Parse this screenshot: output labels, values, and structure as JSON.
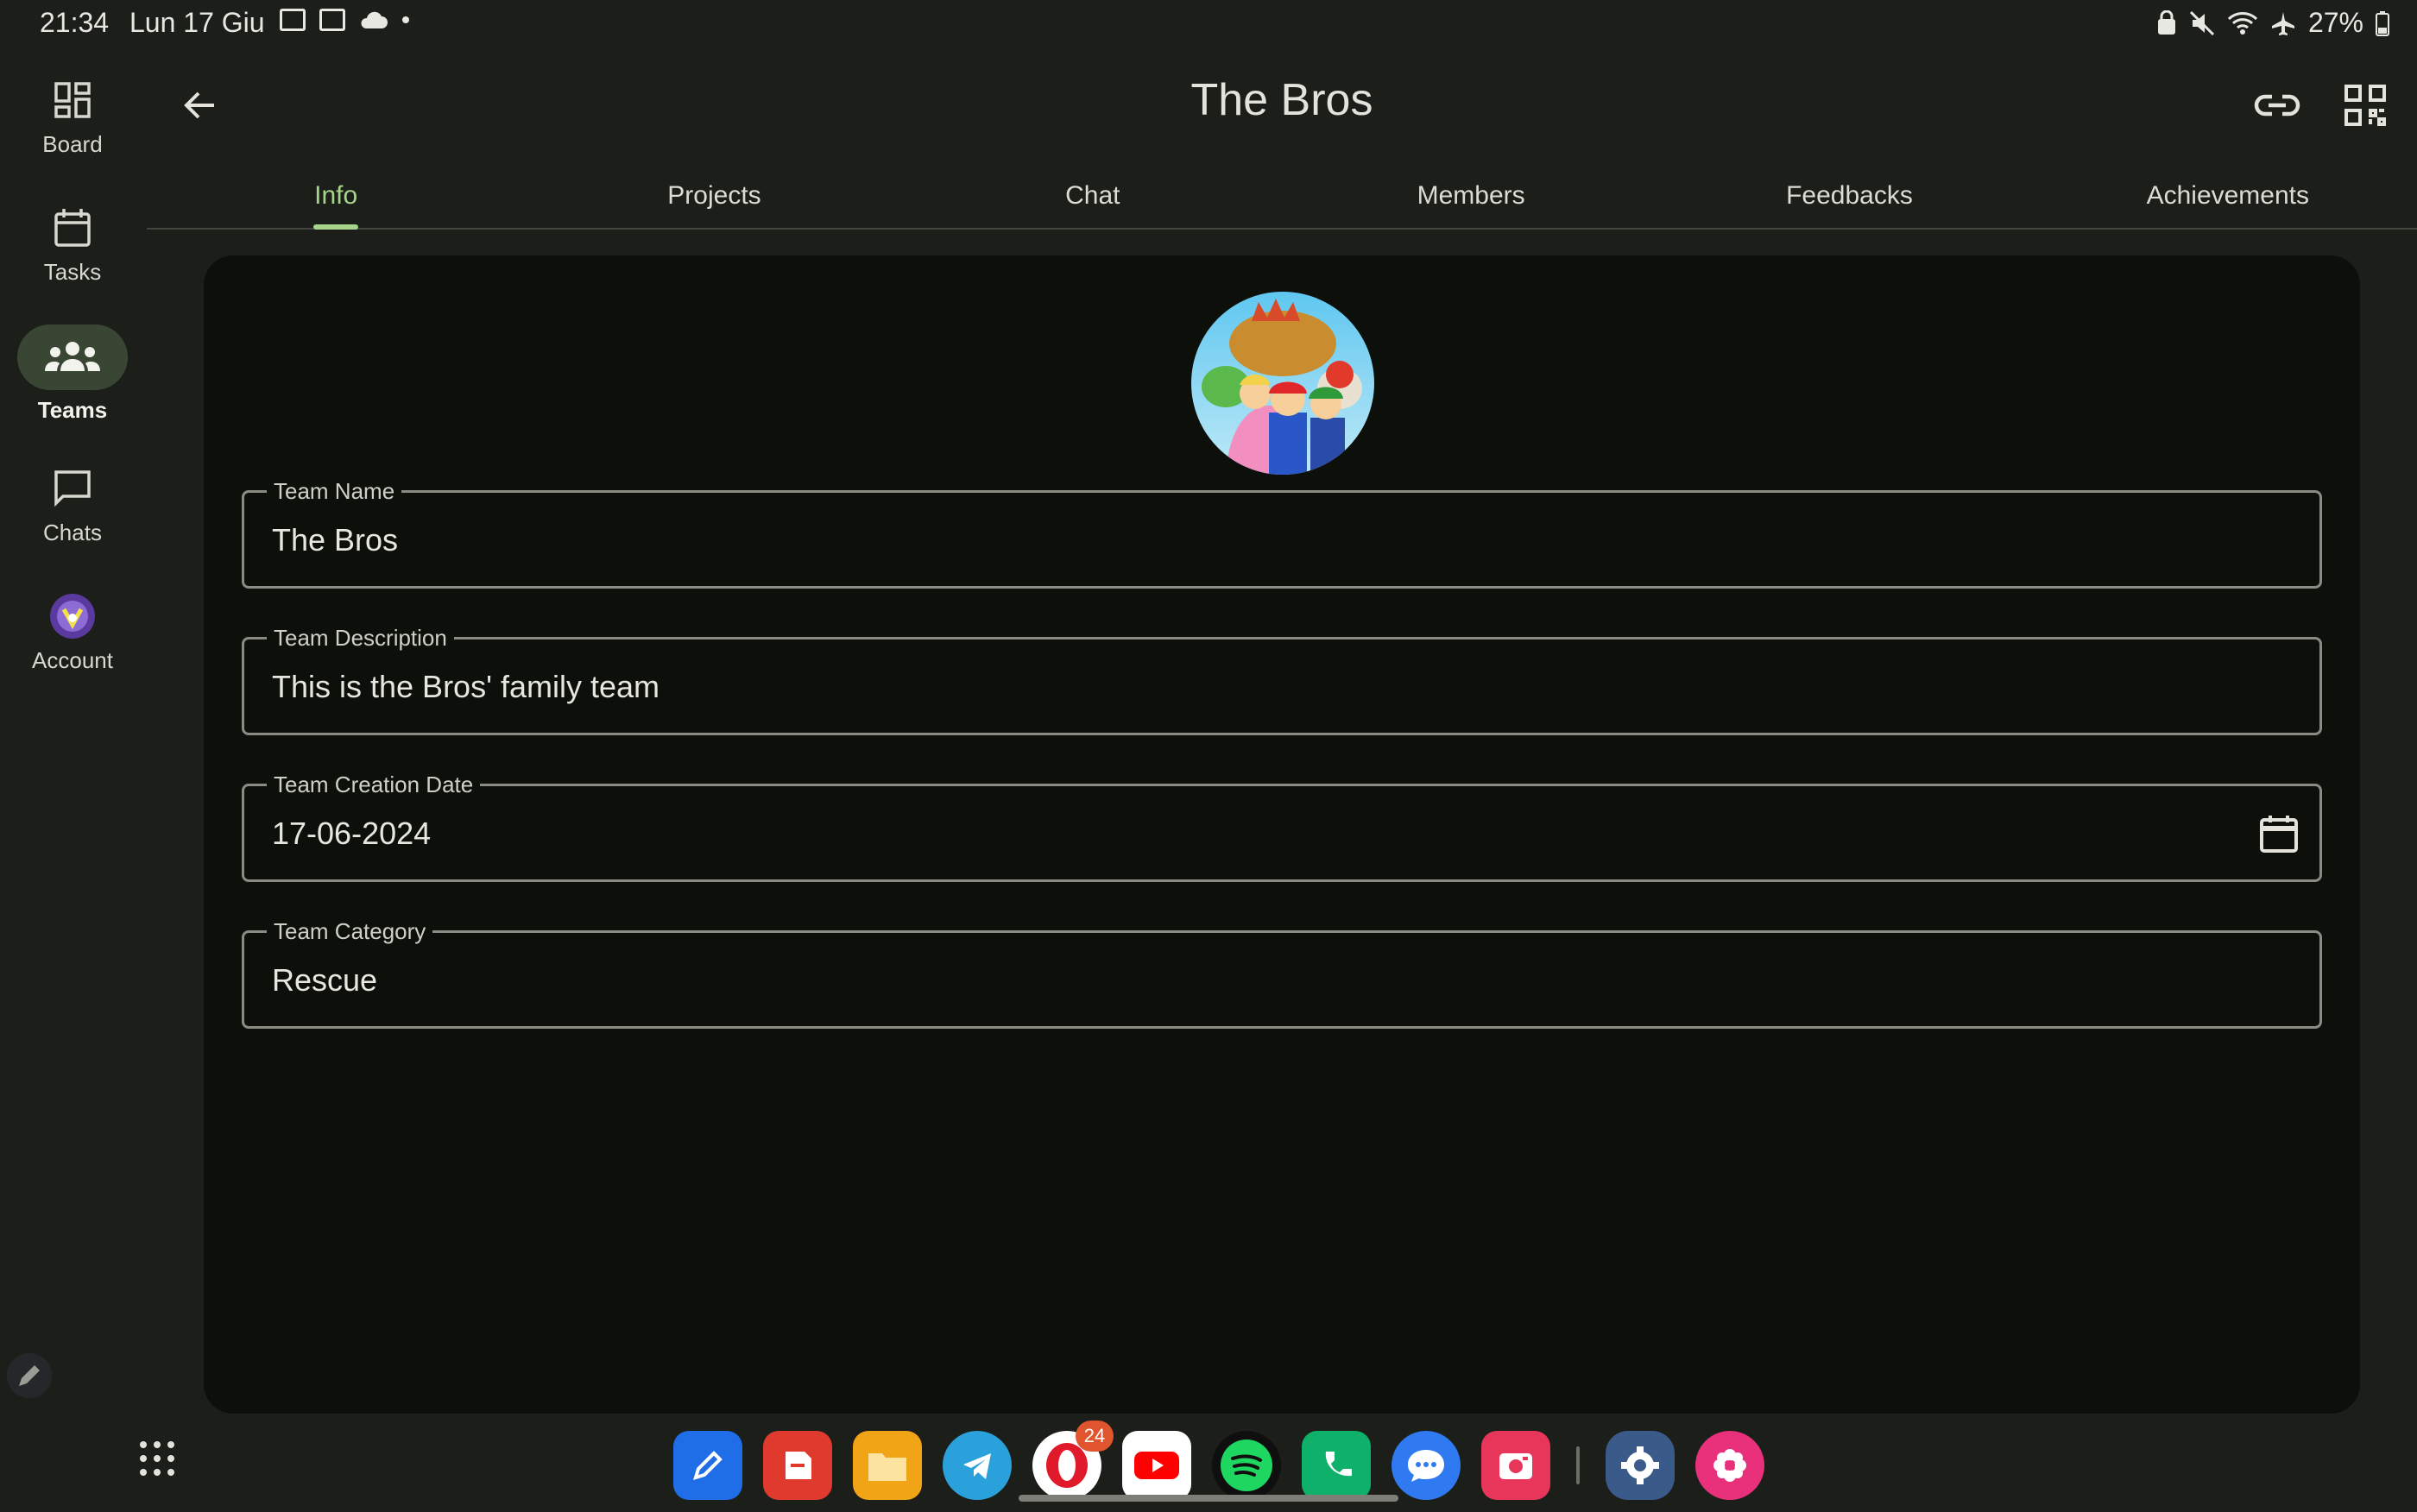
{
  "status_bar": {
    "time": "21:34",
    "date": "Lun 17 Giu",
    "battery": "27%"
  },
  "nav_rail": {
    "items": [
      {
        "label": "Board",
        "icon": "dashboard-icon"
      },
      {
        "label": "Tasks",
        "icon": "calendar-icon"
      },
      {
        "label": "Teams",
        "icon": "groups-icon",
        "active": true
      },
      {
        "label": "Chats",
        "icon": "chat-bubble-icon"
      },
      {
        "label": "Account",
        "icon": "account-avatar"
      }
    ]
  },
  "header": {
    "title": "The Bros"
  },
  "tabs": [
    {
      "label": "Info",
      "active": true
    },
    {
      "label": "Projects"
    },
    {
      "label": "Chat"
    },
    {
      "label": "Members"
    },
    {
      "label": "Feedbacks"
    },
    {
      "label": "Achievements"
    }
  ],
  "form": {
    "team_name": {
      "label": "Team Name",
      "value": "The Bros"
    },
    "team_description": {
      "label": "Team Description",
      "value": "This is the Bros' family team"
    },
    "team_creation_date": {
      "label": "Team Creation Date",
      "value": "17-06-2024"
    },
    "team_category": {
      "label": "Team Category",
      "value": "Rescue"
    }
  },
  "dock": {
    "apps": [
      "notes-app",
      "pdf-app",
      "files-app",
      "telegram-app",
      "opera-app",
      "youtube-app",
      "spotify-app",
      "phone-app",
      "messages-app",
      "screen-recorder-app",
      "settings-app",
      "flower-app"
    ],
    "opera_badge": "24"
  },
  "colors": {
    "background": "#1c1e1a",
    "card": "#0d0f0b",
    "accent": "#a5d48a",
    "rail_active": "#3a4634"
  }
}
